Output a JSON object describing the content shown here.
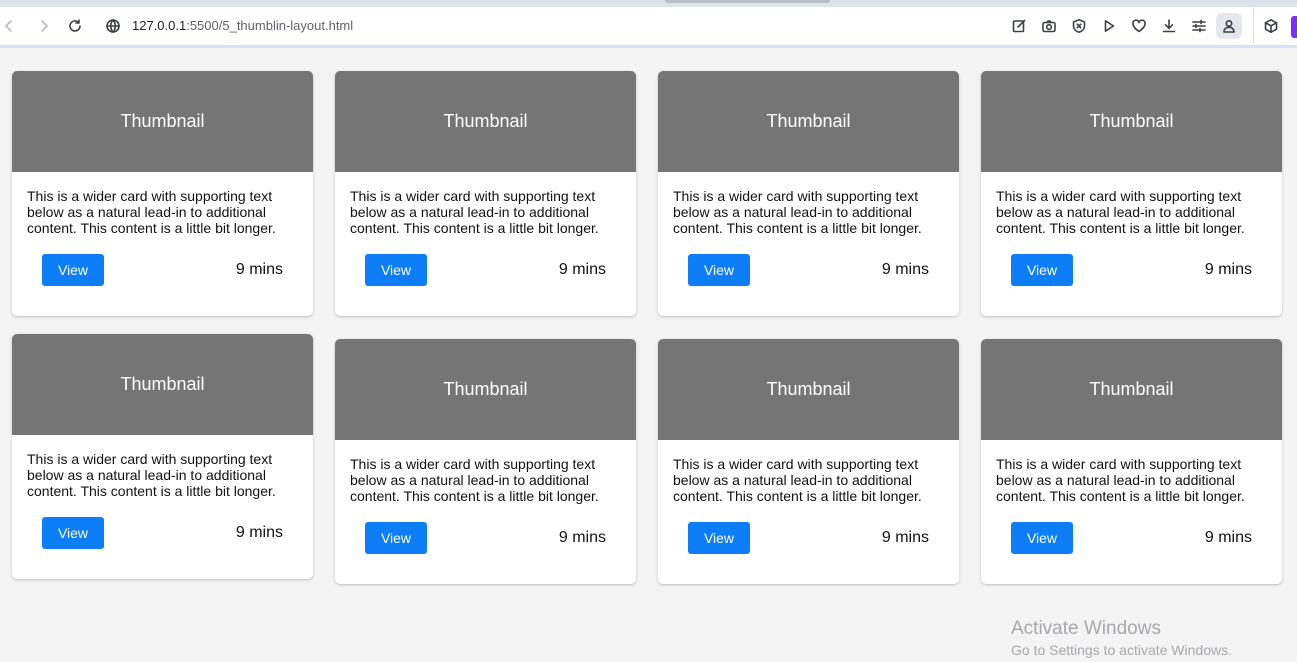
{
  "browser": {
    "url_host": "127.0.0.1",
    "url_path": ":5500/5_thumblin-layout.html"
  },
  "cards": [
    {
      "thumbnail": "Thumbnail",
      "text": "This is a wider card with supporting text below as a natural lead-in to additional content. This content is a little bit longer.",
      "button": "View",
      "time": "9 mins"
    },
    {
      "thumbnail": "Thumbnail",
      "text": "This is a wider card with supporting text below as a natural lead-in to additional content. This content is a little bit longer.",
      "button": "View",
      "time": "9 mins"
    },
    {
      "thumbnail": "Thumbnail",
      "text": "This is a wider card with supporting text below as a natural lead-in to additional content. This content is a little bit longer.",
      "button": "View",
      "time": "9 mins"
    },
    {
      "thumbnail": "Thumbnail",
      "text": "This is a wider card with supporting text below as a natural lead-in to additional content. This content is a little bit longer.",
      "button": "View",
      "time": "9 mins"
    },
    {
      "thumbnail": "Thumbnail",
      "text": "This is a wider card with supporting text below as a natural lead-in to additional content. This content is a little bit longer.",
      "button": "View",
      "time": "9 mins"
    },
    {
      "thumbnail": "Thumbnail",
      "text": "This is a wider card with supporting text below as a natural lead-in to additional content. This content is a little bit longer.",
      "button": "View",
      "time": "9 mins"
    },
    {
      "thumbnail": "Thumbnail",
      "text": "This is a wider card with supporting text below as a natural lead-in to additional content. This content is a little bit longer.",
      "button": "View",
      "time": "9 mins"
    },
    {
      "thumbnail": "Thumbnail",
      "text": "This is a wider card with supporting text below as a natural lead-in to additional content. This content is a little bit longer.",
      "button": "View",
      "time": "9 mins"
    }
  ],
  "watermark": {
    "title": "Activate Windows",
    "subtitle": "Go to Settings to activate Windows."
  },
  "colors": {
    "page_background": "#f4f4f5",
    "thumbnail": "#757575",
    "button": "#0d7ef8"
  }
}
